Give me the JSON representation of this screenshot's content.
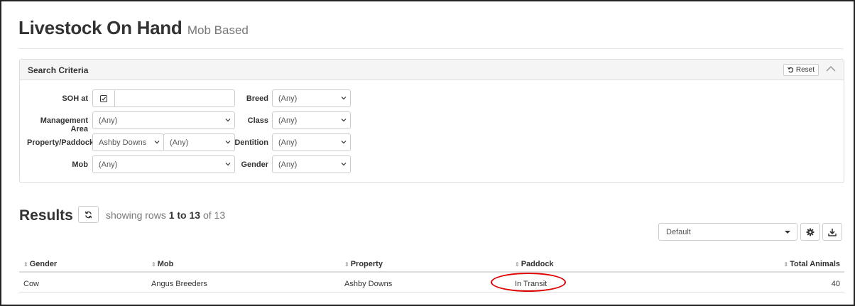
{
  "header": {
    "title": "Livestock On Hand",
    "subtitle": "Mob Based"
  },
  "search": {
    "title": "Search Criteria",
    "reset_label": "Reset",
    "fields": {
      "soh_label": "SOH at",
      "soh_value": "",
      "management_area_label": "Management Area",
      "management_area_value": "(Any)",
      "property_paddock_label": "Property/Paddock",
      "property_value": "Ashby Downs",
      "paddock_value": "(Any)",
      "mob_label": "Mob",
      "mob_value": "(Any)",
      "breed_label": "Breed",
      "breed_value": "(Any)",
      "class_label": "Class",
      "class_value": "(Any)",
      "dentition_label": "Dentition",
      "dentition_value": "(Any)",
      "gender_label": "Gender",
      "gender_value": "(Any)"
    }
  },
  "results": {
    "title": "Results",
    "showing_prefix": "showing rows",
    "showing_range": "1 to 13",
    "showing_of": "of 13",
    "view_select": "Default",
    "columns": [
      "Gender",
      "Mob",
      "Property",
      "Paddock",
      "Total Animals"
    ],
    "rows": [
      [
        "Cow",
        "Angus Breeders",
        "Ashby Downs",
        "In Transit",
        "40"
      ]
    ]
  },
  "colors": {
    "highlight": "#dd0000",
    "border": "#dddddd"
  }
}
